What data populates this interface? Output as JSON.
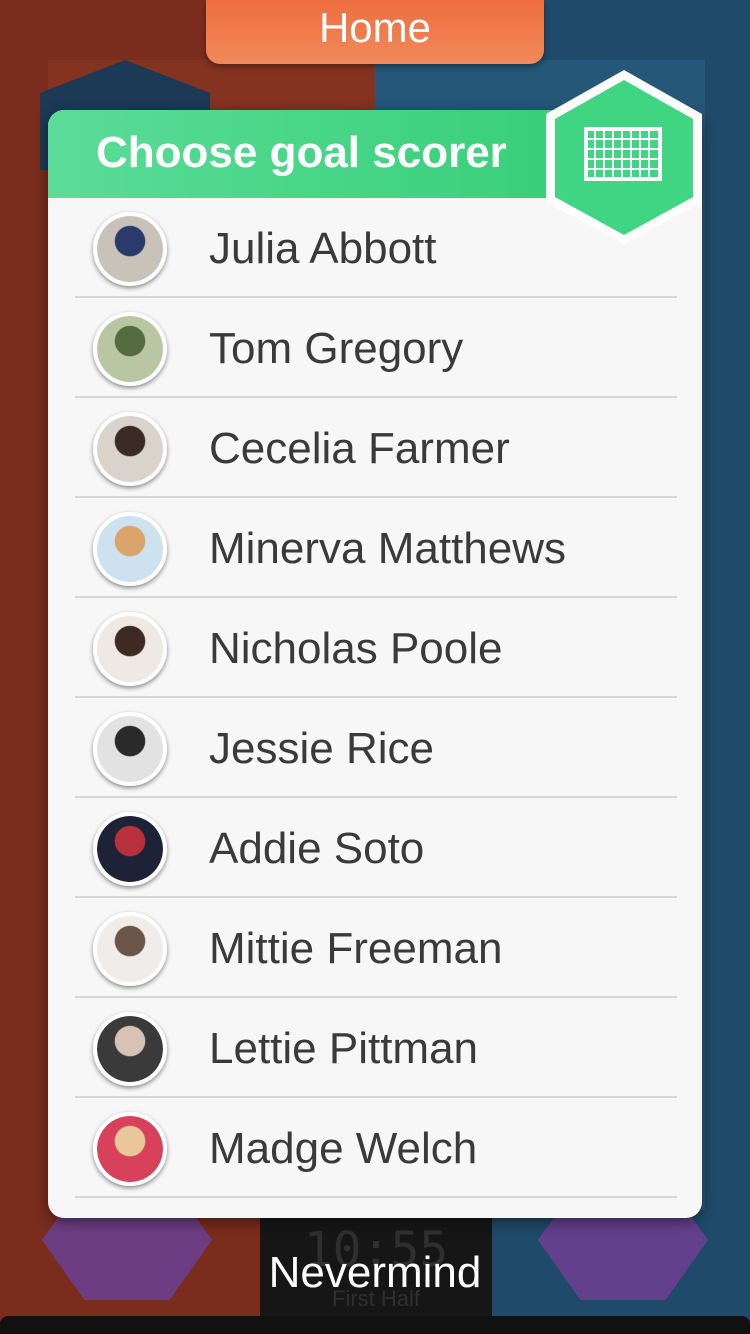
{
  "header": {
    "home_label": "Home"
  },
  "modal": {
    "title": "Choose goal scorer",
    "goal_icon": "goal-net-icon",
    "accent_color": "#2ecc71"
  },
  "players": [
    {
      "name": "Julia Abbott",
      "avatar_colors": [
        "#c9c2b8",
        "#2a3b6b"
      ]
    },
    {
      "name": "Tom Gregory",
      "avatar_colors": [
        "#b9c6a4",
        "#556b3f"
      ]
    },
    {
      "name": "Cecelia Farmer",
      "avatar_colors": [
        "#d9d3cc",
        "#3a2c25"
      ]
    },
    {
      "name": "Minerva Matthews",
      "avatar_colors": [
        "#cde1ee",
        "#d9a46a"
      ]
    },
    {
      "name": "Nicholas Poole",
      "avatar_colors": [
        "#efe9e4",
        "#3e2a22"
      ]
    },
    {
      "name": "Jessie Rice",
      "avatar_colors": [
        "#e2e2e2",
        "#2a2a2a"
      ]
    },
    {
      "name": "Addie Soto",
      "avatar_colors": [
        "#1d2236",
        "#b8303b"
      ]
    },
    {
      "name": "Mittie Freeman",
      "avatar_colors": [
        "#efece9",
        "#6b5448"
      ]
    },
    {
      "name": "Lettie Pittman",
      "avatar_colors": [
        "#3a3a3a",
        "#d7c3b5"
      ]
    },
    {
      "name": "Madge Welch",
      "avatar_colors": [
        "#d8415a",
        "#e8c89a"
      ]
    }
  ],
  "footer": {
    "dismiss_label": "Nevermind"
  },
  "background": {
    "timer": "10:55",
    "period": "First Half"
  }
}
